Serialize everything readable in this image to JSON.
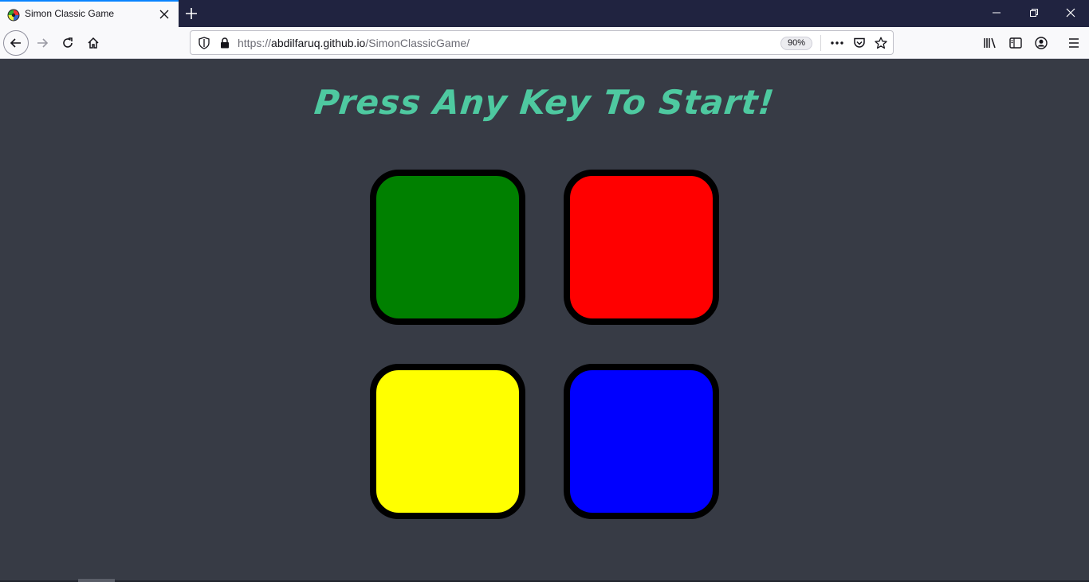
{
  "browser": {
    "tab": {
      "title": "Simon Classic Game",
      "favicon": "simon-favicon-icon",
      "active_color": "#0a84ff"
    },
    "url": {
      "scheme": "https://",
      "host": "abdilfaruq.github.io",
      "path": "/SimonClassicGame/"
    },
    "zoom": "90%",
    "colors": {
      "tabstrip": "#202340",
      "toolbar": "#f9f9fb"
    }
  },
  "page": {
    "background": "#373b45",
    "level_title": "Press Any Key To Start!",
    "title_color": "#4ec9a0",
    "buttons": [
      {
        "id": "green",
        "color": "#008000"
      },
      {
        "id": "red",
        "color": "#ff0000"
      },
      {
        "id": "yellow",
        "color": "#ffff00"
      },
      {
        "id": "blue",
        "color": "#0000ff"
      }
    ]
  }
}
